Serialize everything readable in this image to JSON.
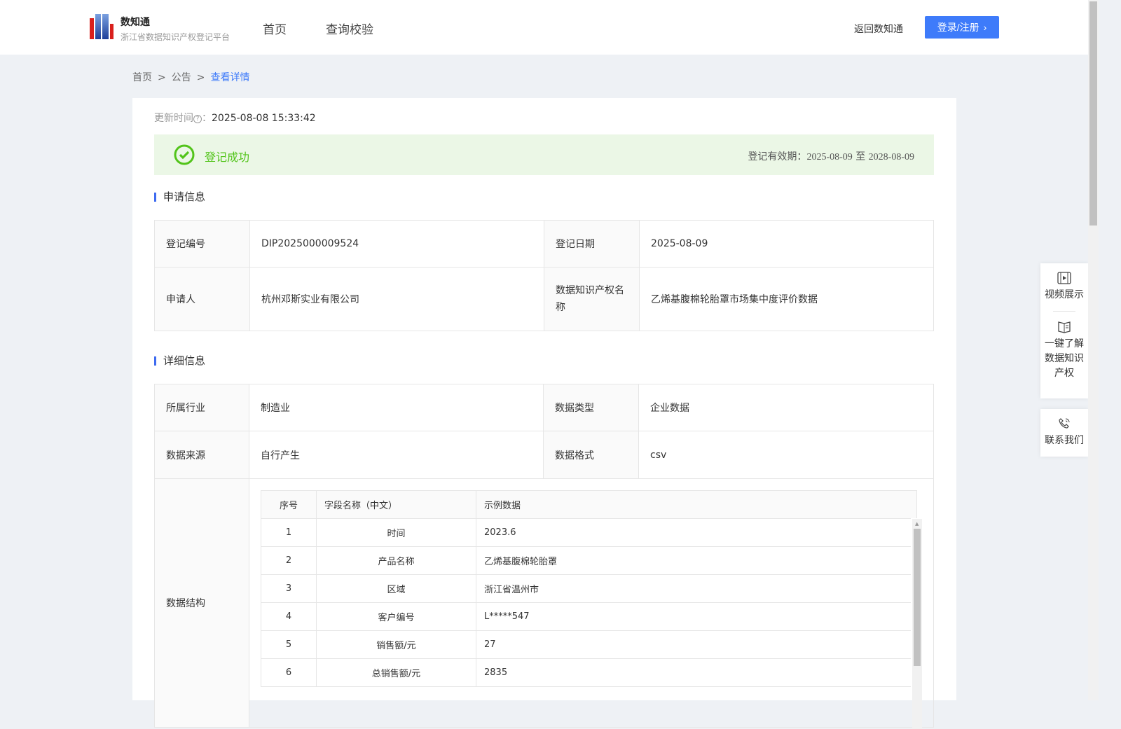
{
  "header": {
    "brand_title": "数知通",
    "brand_subtitle": "浙江省数据知识产权登记平台",
    "nav": [
      "首页",
      "查询校验"
    ],
    "back_link": "返回数知通",
    "login_button": "登录/注册"
  },
  "breadcrumb": {
    "items": [
      "首页",
      "公告",
      "查看详情"
    ],
    "separator": ">"
  },
  "update": {
    "label": "更新时间",
    "colon": "：",
    "value": "2025-08-08 15:33:42"
  },
  "status": {
    "text": "登记成功",
    "validity_label": "登记有效期：",
    "start": "2025-08-09",
    "to": "至",
    "end": "2028-08-09",
    "color": "#52c41a"
  },
  "apply_section": {
    "title": "申请信息",
    "rows": [
      {
        "k1": "登记编号",
        "v1": "DIP2025000009524",
        "k2": "登记日期",
        "v2": "2025-08-09"
      },
      {
        "k1": "申请人",
        "v1": "杭州邓斯实业有限公司",
        "k2": "数据知识产权名称",
        "v2": "乙烯基腹棉轮胎罩市场集中度评价数据"
      }
    ]
  },
  "detail_section": {
    "title": "详细信息",
    "rows": [
      {
        "k1": "所属行业",
        "v1": "制造业",
        "k2": "数据类型",
        "v2": "企业数据"
      },
      {
        "k1": "数据来源",
        "v1": "自行产生",
        "k2": "数据格式",
        "v2": "csv"
      }
    ],
    "structure_label": "数据结构",
    "structure": {
      "headers": [
        "序号",
        "字段名称（中文）",
        "示例数据"
      ],
      "rows": [
        [
          "1",
          "时间",
          "2023.6"
        ],
        [
          "2",
          "产品名称",
          "乙烯基腹棉轮胎罩"
        ],
        [
          "3",
          "区域",
          "浙江省温州市"
        ],
        [
          "4",
          "客户编号",
          "L*****547"
        ],
        [
          "5",
          "销售额/元",
          "27"
        ],
        [
          "6",
          "总销售额/元",
          "2835"
        ]
      ]
    }
  },
  "float_panel": {
    "video": "视频展示",
    "learn": [
      "一键了解",
      "数据知识",
      "产权"
    ],
    "contact": "联系我们"
  }
}
